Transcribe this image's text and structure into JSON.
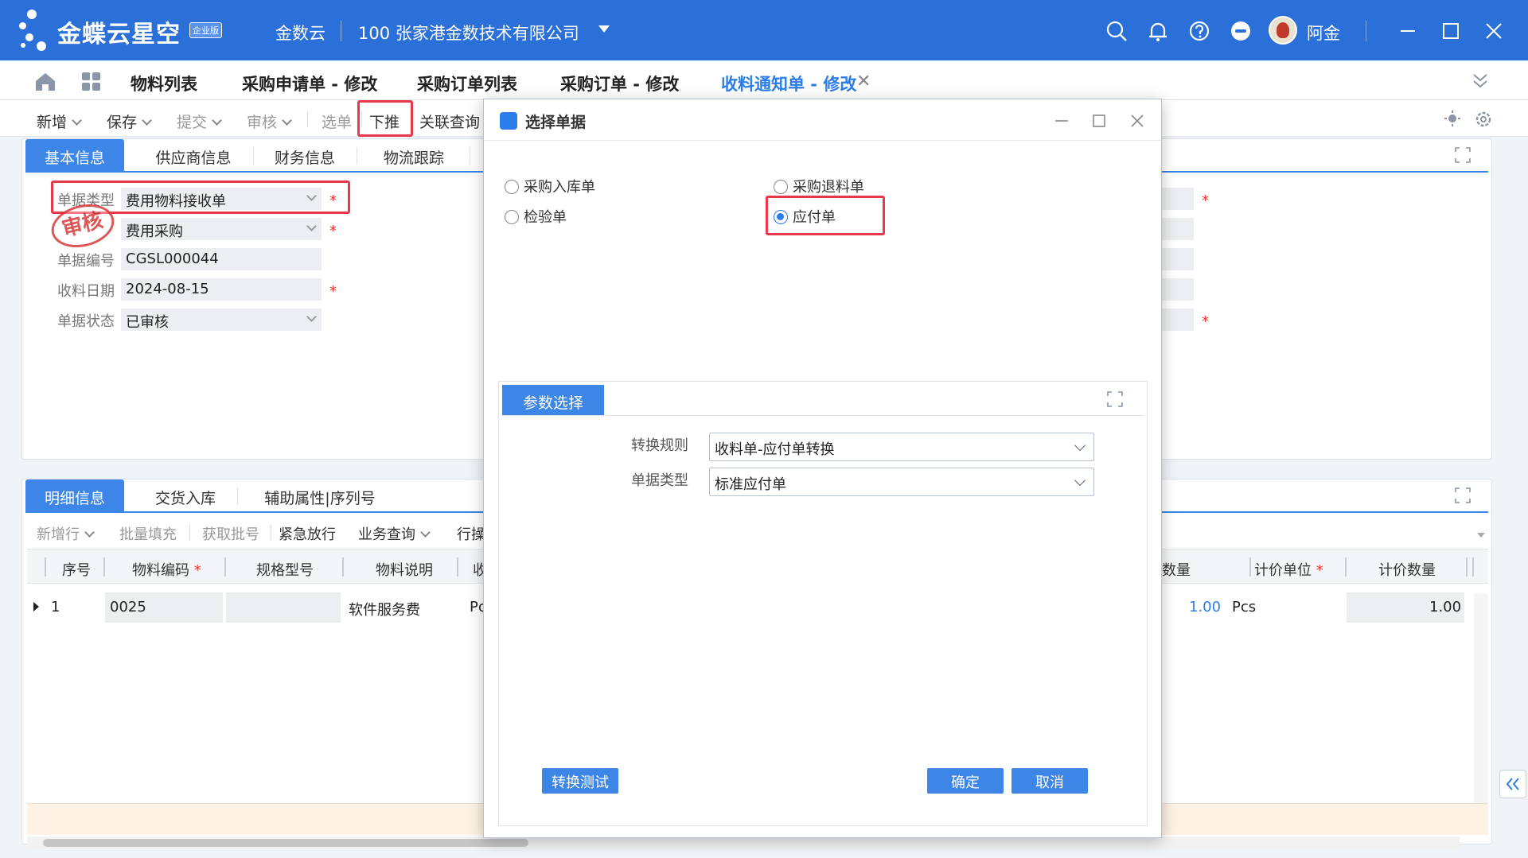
{
  "header": {
    "brand": "金蝶云星空",
    "edition_badge": "企业版",
    "cloud_label": "金数云",
    "org": "100  张家港金数技术有限公司",
    "user_name": "阿金",
    "brand_color": "#2b6fd9"
  },
  "tabs": [
    {
      "label": "物料列表"
    },
    {
      "label": "采购申请单 - 修改"
    },
    {
      "label": "采购订单列表"
    },
    {
      "label": "采购订单 - 修改"
    },
    {
      "label": "收料通知单 - 修改",
      "active": true
    }
  ],
  "toolbar": {
    "new": "新增",
    "save": "保存",
    "submit": "提交",
    "audit": "审核",
    "select_bill": "选单",
    "push_down": "下推",
    "linked_query": "关联查询"
  },
  "header_panel": {
    "tabs": [
      "基本信息",
      "供应商信息",
      "财务信息",
      "物流跟踪"
    ],
    "fields": {
      "bill_type_label": "单据类型",
      "bill_type_value": "费用物料接收单",
      "business_type_value": "费用采购",
      "bill_no_label": "单据编号",
      "bill_no_value": "CGSL000044",
      "receive_date_label": "收料日期",
      "receive_date_value": "2024-08-15",
      "status_label": "单据状态",
      "status_value": "已审核"
    },
    "stamp": "审核"
  },
  "detail_panel": {
    "tabs": [
      "明细信息",
      "交货入库",
      "辅助属性|序列号"
    ],
    "toolbar": {
      "add_row": "新增行",
      "batch_fill": "批量填充",
      "get_lot": "获取批号",
      "urgent_release": "紧急放行",
      "business_query": "业务查询",
      "row_op": "行操"
    },
    "columns": [
      "序号",
      "物料编码",
      "规格型号",
      "物料说明",
      "收",
      "数量",
      "计价单位",
      "计价数量"
    ],
    "rows": [
      {
        "seq": "1",
        "material_code": "0025",
        "spec": "",
        "description": "软件服务费",
        "unit": "Pc",
        "qty": "1.00",
        "price_unit": "Pcs",
        "price_qty": "1.00"
      }
    ]
  },
  "dialog": {
    "title": "选择单据",
    "options": [
      {
        "label": "采购入库单",
        "checked": false
      },
      {
        "label": "采购退料单",
        "checked": false
      },
      {
        "label": "检验单",
        "checked": false
      },
      {
        "label": "应付单",
        "checked": true
      }
    ],
    "param_tab": "参数选择",
    "convert_rule_label": "转换规则",
    "convert_rule_value": "收料单-应付单转换",
    "bill_type_label": "单据类型",
    "bill_type_value": "标准应付单",
    "test_button": "转换测试",
    "ok_button": "确定",
    "cancel_button": "取消"
  }
}
